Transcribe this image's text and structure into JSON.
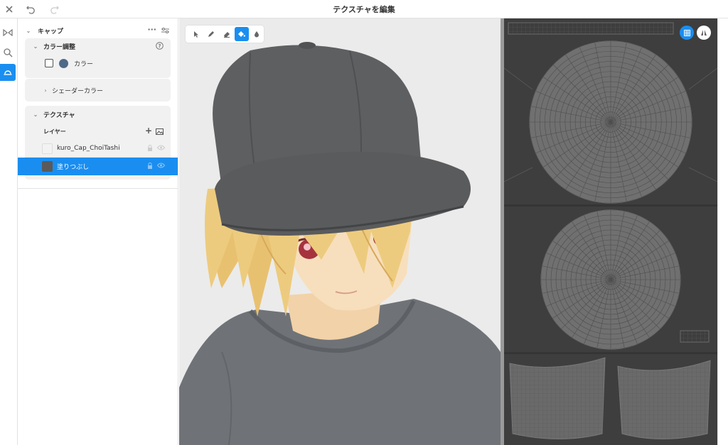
{
  "topbar": {
    "title": "テクスチャを編集"
  },
  "panel": {
    "section_title": "キャップ",
    "color_adjust": {
      "title": "カラー調整",
      "color_label": "カラー"
    },
    "shader_color_label": "シェーダーカラー",
    "texture": {
      "title": "テクスチャ",
      "layers_label": "レイヤー",
      "layers": [
        {
          "name": "kuro_Cap_ChoiTashi",
          "selected": false
        },
        {
          "name": "塗りつぶし",
          "selected": true
        }
      ]
    }
  },
  "colors": {
    "accent": "#1a8ef0",
    "cap_color_swatch": "#4f6a87",
    "fill_layer_thumb": "#5a5a5a"
  }
}
